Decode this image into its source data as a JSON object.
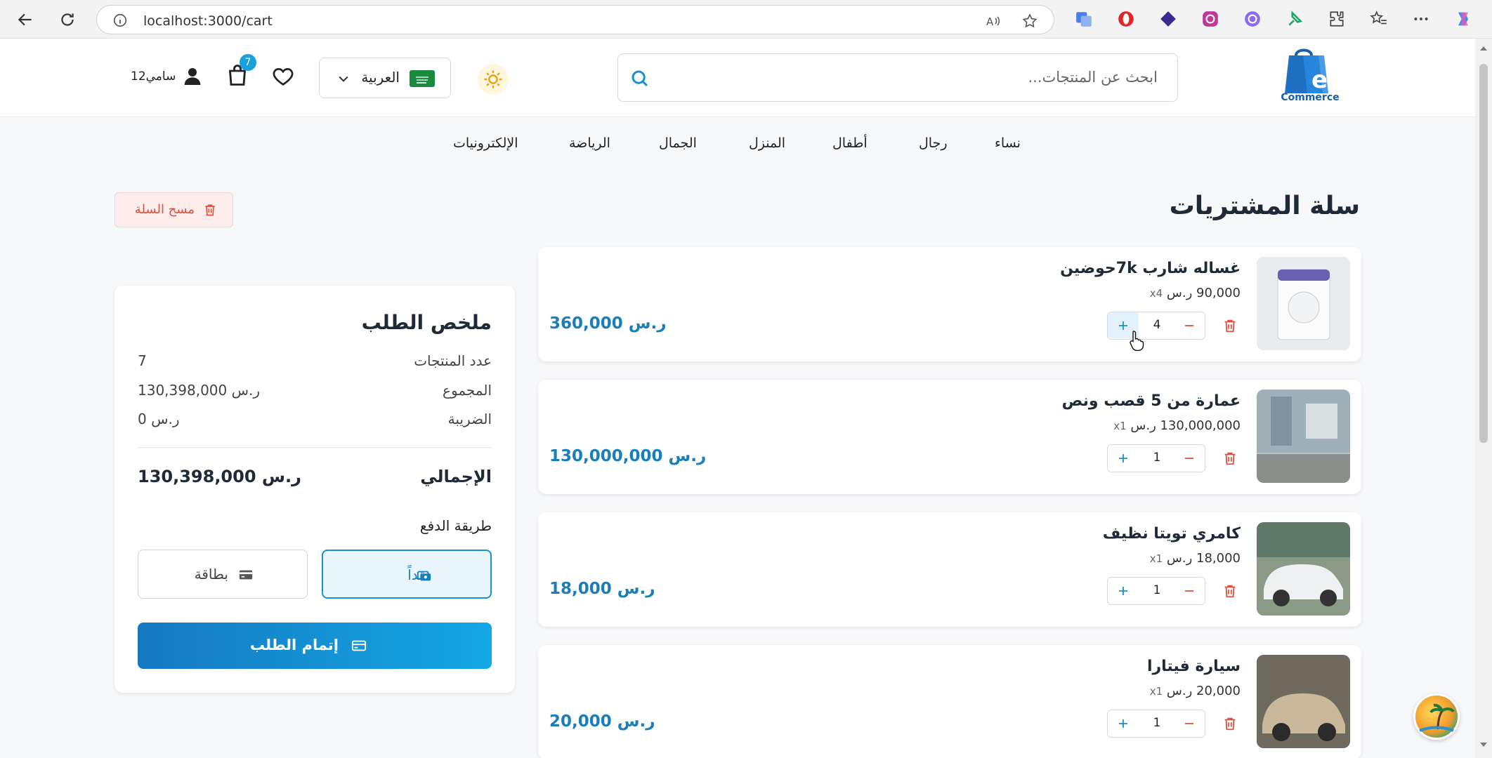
{
  "browser": {
    "url": "localhost:3000/cart"
  },
  "header": {
    "logo_text": "Commerce",
    "search_placeholder": "ابحث عن المنتجات...",
    "language": "العربية",
    "cart_count": "7",
    "user_name": "سامي12"
  },
  "categories": [
    "نساء",
    "رجال",
    "أطفال",
    "المنزل",
    "الجمال",
    "الرياضة",
    "الإلكترونيات"
  ],
  "page": {
    "title": "سلة المشتريات",
    "clear_label": "مسح السلة"
  },
  "cart_items": [
    {
      "name": "غساله شارب 7kحوضين",
      "unit": "90,000 ر.س",
      "mult": "x4",
      "qty": "4",
      "total": "360,000 ر.س"
    },
    {
      "name": "عمارة من 5 قصب ونص",
      "unit": "130,000,000 ر.س",
      "mult": "x1",
      "qty": "1",
      "total": "130,000,000 ر.س"
    },
    {
      "name": "كامري تويتا نظيف",
      "unit": "18,000 ر.س",
      "mult": "x1",
      "qty": "1",
      "total": "18,000 ر.س"
    },
    {
      "name": "سيارة فيتارا",
      "unit": "20,000 ر.س",
      "mult": "x1",
      "qty": "1",
      "total": "20,000 ر.س"
    }
  ],
  "summary": {
    "title": "ملخص الطلب",
    "count_label": "عدد المنتجات",
    "count_value": "7",
    "subtotal_label": "المجموع",
    "subtotal_value": "130,398,000 ر.س",
    "tax_label": "الضريبة",
    "tax_value": "0 ر.س",
    "total_label": "الإجمالي",
    "total_value": "130,398,000 ر.س",
    "payment_label": "طريقة الدفع",
    "cash_label": "نقداً",
    "card_label": "بطاقة",
    "checkout_label": "إتمام الطلب"
  },
  "colors": {
    "accent": "#1a90cc",
    "price": "#1a7fb8",
    "danger": "#e0503e"
  }
}
